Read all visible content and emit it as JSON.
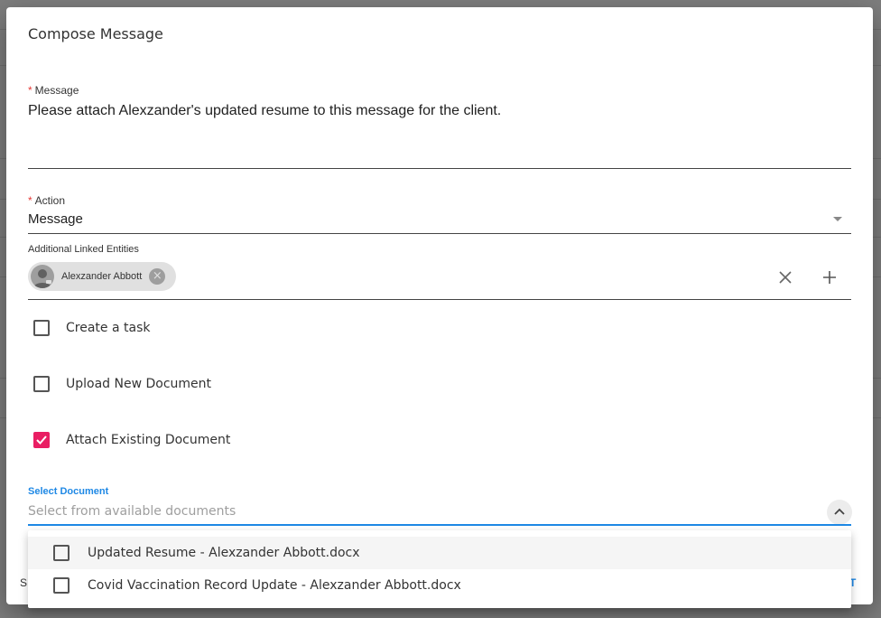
{
  "dialog": {
    "title": "Compose Message",
    "message": {
      "required_mark": "*",
      "label": "Message",
      "value": "Please attach Alexzander's updated resume to this message for the client."
    },
    "action": {
      "required_mark": "*",
      "label": "Action",
      "value": "Message"
    },
    "linked_entities": {
      "label": "Additional Linked Entities",
      "chips": [
        {
          "label": "Alexzander Abbott"
        }
      ],
      "clear_icon": "close-icon",
      "add_icon": "plus-icon"
    },
    "checkboxes": [
      {
        "label": "Create a task",
        "checked": false
      },
      {
        "label": "Upload New Document",
        "checked": false
      },
      {
        "label": "Attach Existing Document",
        "checked": true
      }
    ],
    "select_document": {
      "label": "Select Document",
      "placeholder": "Select from available documents",
      "options": [
        {
          "label": "Updated Resume - Alexzander Abbott.docx",
          "checked": false
        },
        {
          "label": "Covid Vaccination Record Update - Alexzander Abbott.docx",
          "checked": false
        }
      ]
    },
    "footer": {
      "left_partial": "S",
      "right_partial": "T"
    }
  },
  "colors": {
    "accent": "#1e88e5",
    "checked": "#e91e63",
    "required": "#e53935"
  }
}
